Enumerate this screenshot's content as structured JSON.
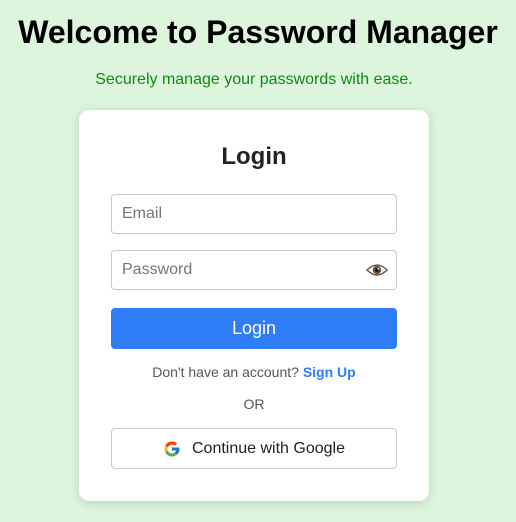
{
  "header": {
    "title": "Welcome to Password Manager",
    "subtitle": "Securely manage your passwords with ease."
  },
  "login_card": {
    "title": "Login",
    "email_placeholder": "Email",
    "password_placeholder": "Password",
    "password_toggle_icon": "eye-icon",
    "login_button_label": "Login",
    "signup_prompt": "Don't have an account?",
    "signup_link_label": "Sign Up",
    "divider_label": "OR",
    "google_button_label": "Continue with Google",
    "google_icon": "google-icon"
  },
  "colors": {
    "background": "#dcf5dc",
    "subtitle": "#118a11",
    "primary": "#2e7cf6",
    "card": "#ffffff"
  }
}
